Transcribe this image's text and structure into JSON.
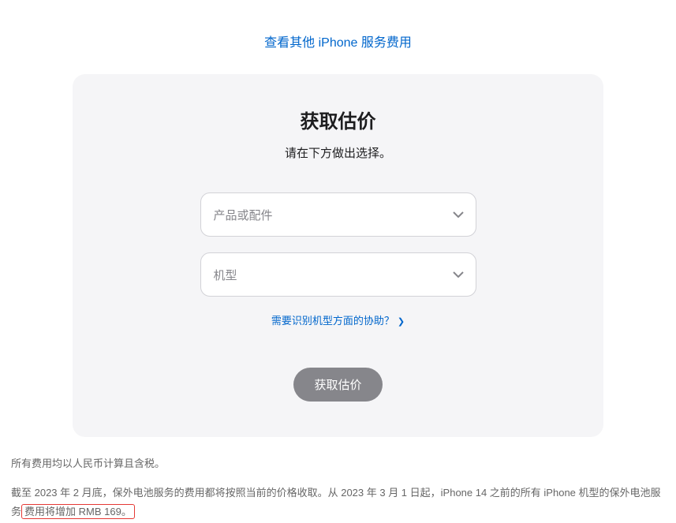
{
  "topLink": {
    "label": "查看其他 iPhone 服务费用"
  },
  "card": {
    "title": "获取估价",
    "subtitle": "请在下方做出选择。",
    "select1": {
      "placeholder": "产品或配件"
    },
    "select2": {
      "placeholder": "机型"
    },
    "helpLink": {
      "label": "需要识别机型方面的协助？"
    },
    "submitButton": {
      "label": "获取估价"
    }
  },
  "footer": {
    "note1": "所有费用均以人民币计算且含税。",
    "note2_part1": "截至 2023 年 2 月底，保外电池服务的费用都将按照当前的价格收取。从 2023 年 3 月 1 日起，iPhone 14 之前的所有 iPhone 机型的保外电池服务",
    "note2_highlight": "费用将增加 RMB 169。"
  }
}
